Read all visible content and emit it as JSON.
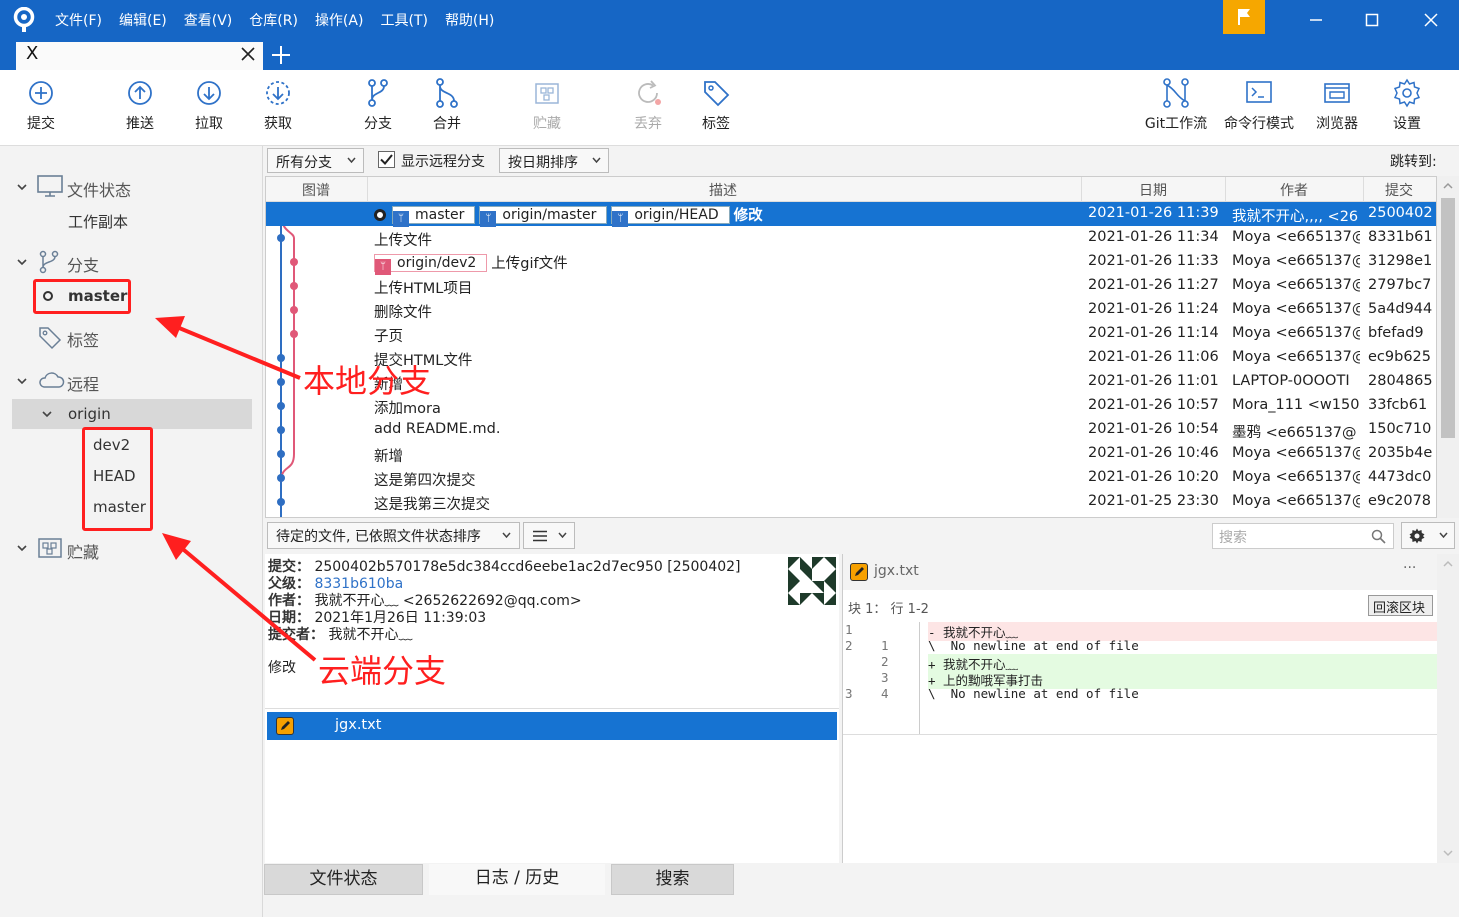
{
  "menu": [
    "文件(F)",
    "编辑(E)",
    "查看(V)",
    "仓库(R)",
    "操作(A)",
    "工具(T)",
    "帮助(H)"
  ],
  "tab": {
    "name": "X",
    "new_tab": "+"
  },
  "toolbar": {
    "commit": "提交",
    "push": "推送",
    "pull": "拉取",
    "fetch": "获取",
    "branch": "分支",
    "merge": "合并",
    "stash": "贮藏",
    "discard": "丢弃",
    "tag": "标签",
    "git_flow": "Git工作流",
    "terminal": "命令行模式",
    "explorer": "浏览器",
    "settings": "设置"
  },
  "sidebar": {
    "file_status": "文件状态",
    "working_copy": "工作副本",
    "branches": "分支",
    "local_branch": "master",
    "tags": "标签",
    "remotes": "远程",
    "remote_name": "origin",
    "remote_branches": [
      "dev2",
      "HEAD",
      "master"
    ],
    "stashes": "贮藏"
  },
  "filters": {
    "branches": "所有分支",
    "show_remote": "显示远程分支",
    "sort": "按日期排序",
    "jump": "跳转到:"
  },
  "columns": {
    "graph": "图谱",
    "desc": "描述",
    "date": "日期",
    "author": "作者",
    "commit": "提交"
  },
  "commits": [
    {
      "desc": "修改",
      "date": "2021-01-26 11:39",
      "author": "我就不开心,,,, <26",
      "hash": "2500402"
    },
    {
      "desc": "上传文件",
      "date": "2021-01-26 11:34",
      "author": "Moya <e665137@",
      "hash": "8331b61"
    },
    {
      "desc": "上传gif文件",
      "date": "2021-01-26 11:33",
      "author": "Moya <e665137@",
      "hash": "31298e1"
    },
    {
      "desc": "上传HTML项目",
      "date": "2021-01-26 11:27",
      "author": "Moya <e665137@",
      "hash": "2797bc7"
    },
    {
      "desc": "删除文件",
      "date": "2021-01-26 11:24",
      "author": "Moya <e665137@",
      "hash": "5a4d944"
    },
    {
      "desc": "子页",
      "date": "2021-01-26 11:14",
      "author": "Moya <e665137@",
      "hash": "bfefad9"
    },
    {
      "desc": "提交HTML文件",
      "date": "2021-01-26 11:06",
      "author": "Moya <e665137@",
      "hash": "ec9b625"
    },
    {
      "desc": "新增",
      "date": "2021-01-26 11:01",
      "author": "LAPTOP-0OOOTI",
      "hash": "2804865"
    },
    {
      "desc": "添加mora",
      "date": "2021-01-26 10:57",
      "author": "Mora_111 <w150",
      "hash": "33fcb61"
    },
    {
      "desc": "add README.md.",
      "date": "2021-01-26 10:54",
      "author": "墨鸦 <e665137@",
      "hash": "150c710"
    },
    {
      "desc": "新增",
      "date": "2021-01-26 10:46",
      "author": "Moya <e665137@",
      "hash": "2035b4e"
    },
    {
      "desc": "这是第四次提交",
      "date": "2021-01-26 10:20",
      "author": "Moya <e665137@",
      "hash": "4473dc0"
    },
    {
      "desc": "这是我第三次提交",
      "date": "2021-01-25 23:30",
      "author": "Moya <e665137@",
      "hash": "e9c2078"
    }
  ],
  "branch_labels": {
    "master": "master",
    "origin_master": "origin/master",
    "origin_head": "origin/HEAD",
    "origin_dev2": "origin/dev2"
  },
  "lower": {
    "pending_sort": "待定的文件, 已依照文件状态排序",
    "search_placeholder": "搜索"
  },
  "detail": {
    "commit_label": "提交：",
    "commit_value": "2500402b570178e5dc384ccd6eebe1ac2d7ec950 [2500402]",
    "parent_label": "父级：",
    "parent_value": "8331b610ba",
    "author_label": "作者：",
    "author_value": "我就不开心﹏ <2652622692@qq.com>",
    "date_label": "日期：",
    "date_value": "2021年1月26日 11:39:03",
    "committer_label": "提交者：",
    "committer_value": "我就不开心﹏",
    "message": "修改"
  },
  "file": {
    "name": "jgx.txt"
  },
  "diff": {
    "file": "jgx.txt",
    "more": "···",
    "hunk": "块 1： 行 1-2",
    "revert": "回滚区块",
    "lines": [
      {
        "type": "del",
        "old": "1",
        "new": "",
        "text": "- 我就不开心﹏"
      },
      {
        "type": "ctx",
        "old": "2",
        "new": "1",
        "text": "\\  No newline at end of file"
      },
      {
        "type": "add",
        "old": "",
        "new": "2",
        "text": "+ 我就不开心﹏"
      },
      {
        "type": "add",
        "old": "",
        "new": "3",
        "text": "+ 上的黝哦军事打击"
      },
      {
        "type": "ctx",
        "old": "3",
        "new": "4",
        "text": "\\  No newline at end of file"
      }
    ]
  },
  "bottom_tabs": [
    "文件状态",
    "日志 / 历史",
    "搜索"
  ],
  "annotations": {
    "local": "本地分支",
    "remote": "云端分支"
  },
  "colors": {
    "titlebar": "#1666c5",
    "selection": "#1673d2",
    "accent_flag": "#f6a700",
    "annotation": "#ff1f1f",
    "graph_blue": "#2e6ec2",
    "graph_pink": "#e05878"
  }
}
